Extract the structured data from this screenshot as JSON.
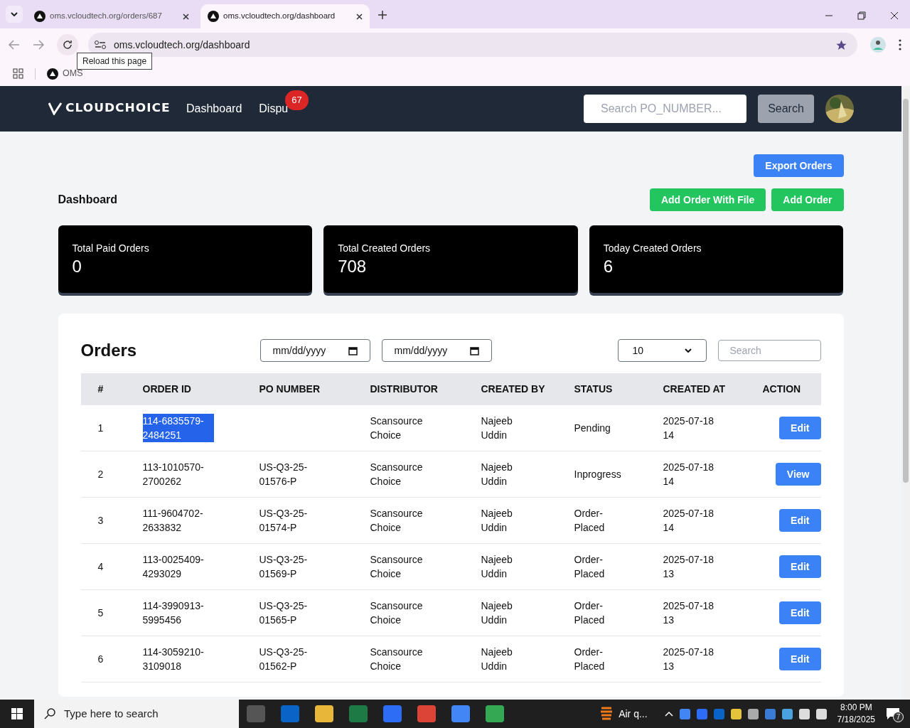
{
  "browser": {
    "tabs": [
      {
        "title": "oms.vcloudtech.org/orders/687",
        "selected": false
      },
      {
        "title": "oms.vcloudtech.org/dashboard",
        "selected": true
      }
    ],
    "address": "oms.vcloudtech.org/dashboard",
    "tooltip": "Reload this page",
    "bookmarks": [
      "OMS"
    ]
  },
  "nav": {
    "logo": "CLOUDCHOICE",
    "links": [
      {
        "label": "Dashboard"
      },
      {
        "label": "Dispu",
        "badge": "67"
      }
    ],
    "search": {
      "placeholder": "Search PO_NUMBER..."
    },
    "search_button": "Search"
  },
  "top_buttons": [
    {
      "label": "Export Orders",
      "kind": "blue"
    }
  ],
  "page_title": "Dashboard",
  "action_buttons": [
    {
      "label": "Add Order With File"
    },
    {
      "label": "Add Order"
    }
  ],
  "stats": [
    {
      "label": "Total Paid Orders",
      "value": "0"
    },
    {
      "label": "Total Created Orders",
      "value": "708"
    },
    {
      "label": "Today Created Orders",
      "value": "6"
    }
  ],
  "orders": {
    "title": "Orders",
    "date_fields": [
      {
        "placeholder": "mm/dd/yyyy"
      },
      {
        "placeholder": "mm/dd/yyyy"
      }
    ],
    "page_size": "10",
    "search": {
      "placeholder": "Search"
    },
    "columns": [
      "#",
      "ORDER ID",
      "PO NUMBER",
      "DISTRIBUTOR",
      "CREATED BY",
      "STATUS",
      "CREATED AT",
      "ACTION"
    ],
    "rows": [
      {
        "cells": [
          "1",
          "114-6835579-2484251",
          "",
          "Scansource Choice",
          "Najeeb Uddin",
          "Pending",
          "2025-07-18 14"
        ],
        "action": "Edit",
        "text_selected": true
      },
      {
        "cells": [
          "2",
          "113-1010570-2700262",
          "US-Q3-25-01576-P",
          "Scansource Choice",
          "Najeeb Uddin",
          "Inprogress",
          "2025-07-18 14"
        ],
        "action": "View",
        "text_selected": false
      },
      {
        "cells": [
          "3",
          "111-9604702-2633832",
          "US-Q3-25-01574-P",
          "Scansource Choice",
          "Najeeb Uddin",
          "Order-Placed",
          "2025-07-18 14"
        ],
        "action": "Edit",
        "text_selected": false
      },
      {
        "cells": [
          "4",
          "113-0025409-4293029",
          "US-Q3-25-01569-P",
          "Scansource Choice",
          "Najeeb Uddin",
          "Order-Placed",
          "2025-07-18 13"
        ],
        "action": "Edit",
        "text_selected": false
      },
      {
        "cells": [
          "5",
          "114-3990913-5995456",
          "US-Q3-25-01565-P",
          "Scansource Choice",
          "Najeeb Uddin",
          "Order-Placed",
          "2025-07-18 13"
        ],
        "action": "Edit",
        "text_selected": false
      },
      {
        "cells": [
          "6",
          "114-3059210-3109018",
          "US-Q3-25-01562-P",
          "Scansource Choice",
          "Najeeb Uddin",
          "Order-Placed",
          "2025-07-18 13"
        ],
        "action": "Edit",
        "text_selected": false
      }
    ]
  },
  "taskbar": {
    "search": {
      "placeholder": "Type here to search"
    },
    "weather": "Air q...",
    "time": "8:00 PM",
    "date": "7/18/2025",
    "notifications": "7"
  }
}
